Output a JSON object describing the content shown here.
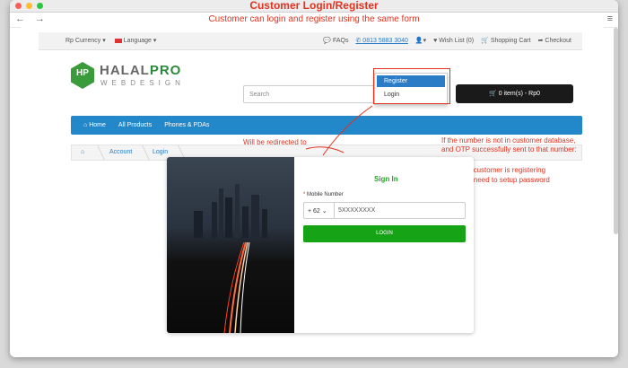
{
  "window": {
    "title": "Customer Login/Register",
    "subtitle": "Customer can login and register using the same form",
    "nav": "← →",
    "menu_icon": "≡"
  },
  "topbar": {
    "currency": "Rp Currency ▾",
    "language": "Language ▾",
    "faqs": "FAQs",
    "phone": "0813 5883 3040",
    "account": "▾",
    "wishlist": "Wish List (0)",
    "cart": "Shopping Cart",
    "checkout": "Checkout"
  },
  "account_menu": {
    "register": "Register",
    "login": "Login"
  },
  "logo": {
    "mark": "HP",
    "brand_a": "HALAL",
    "brand_b": "PRO",
    "sub": "WEBDESIGN"
  },
  "search": {
    "placeholder": "Search"
  },
  "cart_button": "0 item(s) - Rp0",
  "navbar": {
    "home": "Home",
    "all_products": "All Products",
    "phones": "Phones & PDAs"
  },
  "breadcrumb": {
    "account": "Account",
    "login": "Login"
  },
  "annotations": {
    "redirect": "Will be redirected to",
    "not_in_db": "If the number is not in customer database,",
    "otp": "and OTP successfully sent to that number:",
    "meaning": "– Meaning customer is registering",
    "setup": "– They will need to setup password"
  },
  "form": {
    "title": "Sign In",
    "mobile_label": "Mobile Number",
    "prefix": "+ 62  ⌄",
    "phone_placeholder": "5XXXXXXXX",
    "login": "LOGIN"
  },
  "colors": {
    "accent": "#e0321f",
    "brand_green": "#28a32a",
    "nav_blue": "#2388c9"
  }
}
